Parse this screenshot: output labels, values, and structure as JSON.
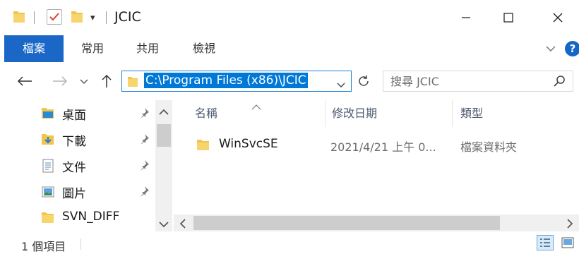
{
  "window": {
    "title": "JCIC",
    "quick_access_dropdown": "▾"
  },
  "ribbon": {
    "tabs": [
      {
        "label": "檔案",
        "active": true
      },
      {
        "label": "常用",
        "active": false
      },
      {
        "label": "共用",
        "active": false
      },
      {
        "label": "檢視",
        "active": false
      }
    ],
    "help": "?"
  },
  "address": {
    "path": "C:\\Program Files (x86)\\JCIC"
  },
  "search": {
    "placeholder": "搜尋 JCIC"
  },
  "nav": {
    "items": [
      {
        "label": "桌面",
        "icon": "desktop-folder-icon",
        "pinned": true
      },
      {
        "label": "下載",
        "icon": "downloads-folder-icon",
        "pinned": true
      },
      {
        "label": "文件",
        "icon": "documents-folder-icon",
        "pinned": true
      },
      {
        "label": "圖片",
        "icon": "pictures-folder-icon",
        "pinned": true
      },
      {
        "label": "SVN_DIFF",
        "icon": "folder-icon",
        "pinned": false
      }
    ]
  },
  "columns": {
    "name": "名稱",
    "modified": "修改日期",
    "type": "類型"
  },
  "files": [
    {
      "name": "WinSvcSE",
      "modified": "2021/4/21 上午 0...",
      "type": "檔案資料夾"
    }
  ],
  "status": {
    "count": "1 個項目"
  },
  "colors": {
    "accent": "#1a67c8",
    "selection": "#0078d7",
    "folder": "#f3c44a"
  }
}
